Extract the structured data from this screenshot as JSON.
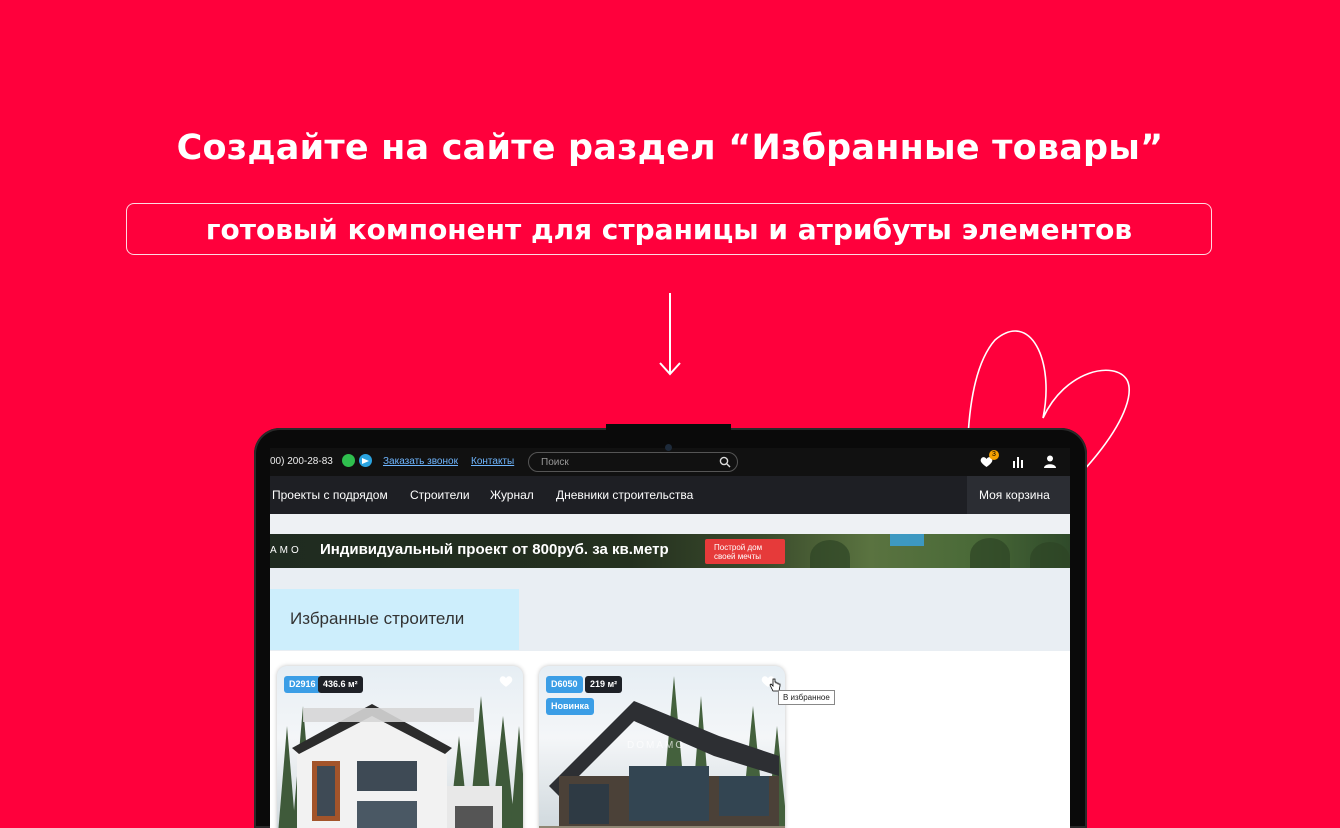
{
  "hero": {
    "title": "Создайте на сайте раздел “Избранные товары”",
    "subtitle": "готовый компонент для страницы и атрибуты элементов"
  },
  "colors": {
    "background": "#ff003c",
    "nav_bg": "#1e1f24",
    "accent_blue": "#3b9ee6",
    "banner_button": "#e63a3a",
    "badge": "#f5a100"
  },
  "topbar": {
    "phone": "00) 200-28-83",
    "call_link": "Заказать звонок",
    "contacts_link": "Контакты",
    "search_placeholder": "Поиск",
    "favorites_count": "3"
  },
  "nav": {
    "items": [
      "Проекты с подрядом",
      "Строители",
      "Журнал",
      "Дневники строительства"
    ],
    "cart": "Моя корзина"
  },
  "banner": {
    "logo": "АМО",
    "text": "Индивидуальный проект от 800руб. за кв.метр",
    "button_line1": "Построй дом",
    "button_line2": "своей мечты"
  },
  "section": {
    "title": "Избранные строители"
  },
  "cards": [
    {
      "code": "D2916",
      "area": "436.6 м²"
    },
    {
      "code": "D6050",
      "area": "219 м²",
      "badge": "Новинка",
      "watermark": "DOMAMO",
      "tooltip": "В избранное"
    }
  ]
}
